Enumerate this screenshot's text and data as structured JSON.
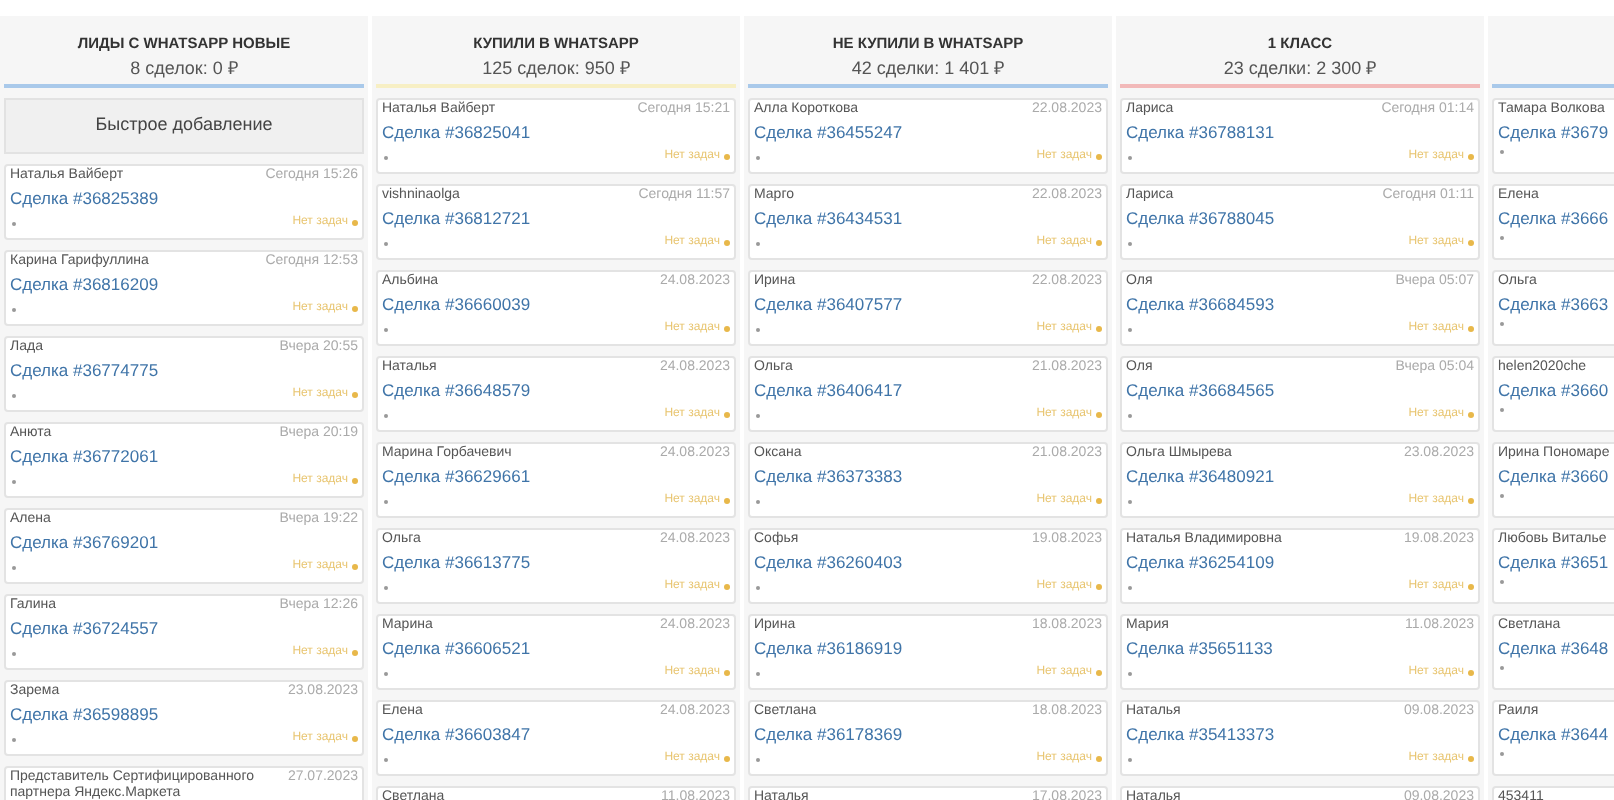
{
  "columns": [
    {
      "title": "ЛИДЫ С WHATSAPP НОВЫЕ",
      "summary": "8 сделок: 0 ₽",
      "color": "#a9c9ea",
      "quick_add": "Быстрое добавление",
      "cards": [
        {
          "name": "Наталья Вайберт",
          "date": "Сегодня 15:26",
          "deal": "Сделка #36825389",
          "task": "Нет задач"
        },
        {
          "name": "Карина Гарифуллина",
          "date": "Сегодня 12:53",
          "deal": "Сделка #36816209",
          "task": "Нет задач"
        },
        {
          "name": "Лада",
          "date": "Вчера 20:55",
          "deal": "Сделка #36774775",
          "task": "Нет задач"
        },
        {
          "name": "Анюта",
          "date": "Вчера 20:19",
          "deal": "Сделка #36772061",
          "task": "Нет задач"
        },
        {
          "name": "Алена",
          "date": "Вчера 19:22",
          "deal": "Сделка #36769201",
          "task": "Нет задач"
        },
        {
          "name": "Галина",
          "date": "Вчера 12:26",
          "deal": "Сделка #36724557",
          "task": "Нет задач"
        },
        {
          "name": "Зарема",
          "date": "23.08.2023",
          "deal": "Сделка #36598895",
          "task": "Нет задач"
        },
        {
          "name": "Представитель Сертифицированного партнера Яндекс.Маркета",
          "date": "27.07.2023"
        }
      ]
    },
    {
      "title": "КУПИЛИ В WHATSAPP",
      "summary": "125 сделок: 950 ₽",
      "color": "#f7efc4",
      "cards": [
        {
          "name": "Наталья Вайберт",
          "date": "Сегодня 15:21",
          "deal": "Сделка #36825041",
          "task": "Нет задач"
        },
        {
          "name": "vishninaolga",
          "date": "Сегодня 11:57",
          "deal": "Сделка #36812721",
          "task": "Нет задач"
        },
        {
          "name": "Альбина",
          "date": "24.08.2023",
          "deal": "Сделка #36660039",
          "task": "Нет задач"
        },
        {
          "name": "Наталья",
          "date": "24.08.2023",
          "deal": "Сделка #36648579",
          "task": "Нет задач"
        },
        {
          "name": "Марина Горбачевич",
          "date": "24.08.2023",
          "deal": "Сделка #36629661",
          "task": "Нет задач"
        },
        {
          "name": "Ольга",
          "date": "24.08.2023",
          "deal": "Сделка #36613775",
          "task": "Нет задач"
        },
        {
          "name": "Марина",
          "date": "24.08.2023",
          "deal": "Сделка #36606521",
          "task": "Нет задач"
        },
        {
          "name": "Елена",
          "date": "24.08.2023",
          "deal": "Сделка #36603847",
          "task": "Нет задач"
        },
        {
          "name": "Светлана",
          "date": "11.08.2023"
        }
      ]
    },
    {
      "title": "НЕ КУПИЛИ В WHATSAPP",
      "summary": "42 сделки: 1 401 ₽",
      "color": "#a9c9ea",
      "cards": [
        {
          "name": "Алла Короткова",
          "date": "22.08.2023",
          "deal": "Сделка #36455247",
          "task": "Нет задач"
        },
        {
          "name": "Марго",
          "date": "22.08.2023",
          "deal": "Сделка #36434531",
          "task": "Нет задач"
        },
        {
          "name": "Ирина",
          "date": "22.08.2023",
          "deal": "Сделка #36407577",
          "task": "Нет задач"
        },
        {
          "name": "Ольга",
          "date": "21.08.2023",
          "deal": "Сделка #36406417",
          "task": "Нет задач"
        },
        {
          "name": "Оксана",
          "date": "21.08.2023",
          "deal": "Сделка #36373383",
          "task": "Нет задач"
        },
        {
          "name": "Софья",
          "date": "19.08.2023",
          "deal": "Сделка #36260403",
          "task": "Нет задач"
        },
        {
          "name": "Ирина",
          "date": "18.08.2023",
          "deal": "Сделка #36186919",
          "task": "Нет задач"
        },
        {
          "name": "Светлана",
          "date": "18.08.2023",
          "deal": "Сделка #36178369",
          "task": "Нет задач"
        },
        {
          "name": "Наталья",
          "date": "17.08.2023"
        }
      ]
    },
    {
      "title": "1 КЛАСС",
      "summary": "23 сделки: 2 300 ₽",
      "color": "#f2b9b9",
      "cards": [
        {
          "name": "Лариса",
          "date": "Сегодня 01:14",
          "deal": "Сделка #36788131",
          "task": "Нет задач"
        },
        {
          "name": "Лариса",
          "date": "Сегодня 01:11",
          "deal": "Сделка #36788045",
          "task": "Нет задач"
        },
        {
          "name": "Оля",
          "date": "Вчера 05:07",
          "deal": "Сделка #36684593",
          "task": "Нет задач"
        },
        {
          "name": "Оля",
          "date": "Вчера 05:04",
          "deal": "Сделка #36684565",
          "task": "Нет задач"
        },
        {
          "name": "Ольга Шмырева",
          "date": "23.08.2023",
          "deal": "Сделка #36480921",
          "task": "Нет задач"
        },
        {
          "name": "Наталья Владимировна",
          "date": "19.08.2023",
          "deal": "Сделка #36254109",
          "task": "Нет задач"
        },
        {
          "name": "Мария",
          "date": "11.08.2023",
          "deal": "Сделка #35651133",
          "task": "Нет задач"
        },
        {
          "name": "Наталья",
          "date": "09.08.2023",
          "deal": "Сделка #35413373",
          "task": "Нет задач"
        },
        {
          "name": "Наталья",
          "date": "09.08.2023"
        }
      ]
    },
    {
      "color": "#a9c9ea",
      "cards": [
        {
          "name": "Тамара Волкова",
          "deal": "Сделка #3679"
        },
        {
          "name": "Елена",
          "deal": "Сделка #3666"
        },
        {
          "name": "Ольга",
          "deal": "Сделка #3663"
        },
        {
          "name": "helen2020che",
          "deal": "Сделка #3660"
        },
        {
          "name": "Ирина Пономаре",
          "deal": "Сделка #3660"
        },
        {
          "name": "Любовь Виталье",
          "deal": "Сделка #3651"
        },
        {
          "name": "Светлана",
          "deal": "Сделка #3648"
        },
        {
          "name": "Раиля",
          "deal": "Сделка #3644"
        },
        {
          "name": "453411"
        }
      ]
    }
  ]
}
